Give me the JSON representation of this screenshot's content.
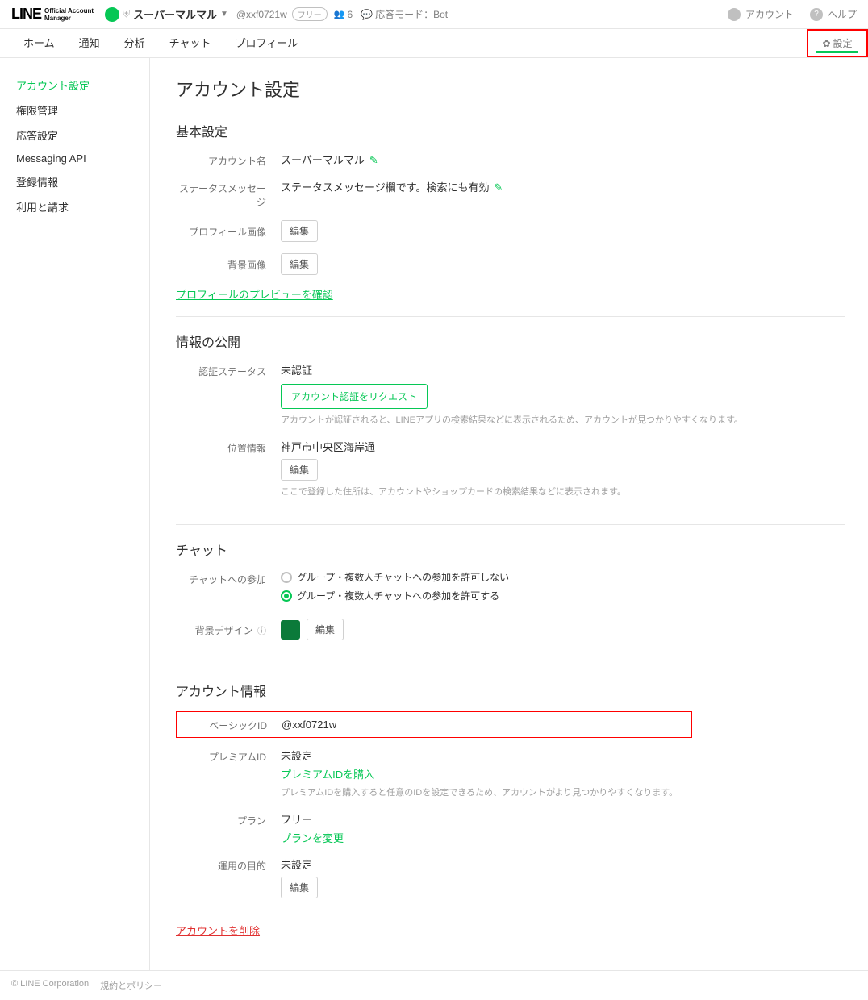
{
  "topbar": {
    "logo": "LINE",
    "logo_sub": "Official Account\nManager",
    "account_name": "スーパーマルマル",
    "handle": "@xxf0721w",
    "plan_pill": "フリー",
    "members": "6",
    "response_mode": "応答モード：Bot",
    "right": {
      "account": "アカウント",
      "help": "ヘルプ"
    }
  },
  "nav": {
    "items": [
      "ホーム",
      "通知",
      "分析",
      "チャット",
      "プロフィール"
    ],
    "settings": "設定"
  },
  "sidebar": {
    "items": [
      "アカウント設定",
      "権限管理",
      "応答設定",
      "Messaging API",
      "登録情報",
      "利用と請求"
    ]
  },
  "page": {
    "title": "アカウント設定"
  },
  "basic": {
    "heading": "基本設定",
    "account_name_label": "アカウント名",
    "account_name_value": "スーパーマルマル",
    "status_label": "ステータスメッセージ",
    "status_value": "ステータスメッセージ欄です。検索にも有効",
    "profile_image_label": "プロフィール画像",
    "bg_image_label": "背景画像",
    "edit": "編集",
    "preview_link": "プロフィールのプレビューを確認"
  },
  "disclosure": {
    "heading": "情報の公開",
    "verify_label": "認証ステータス",
    "verify_value": "未認証",
    "verify_button": "アカウント認証をリクエスト",
    "verify_hint": "アカウントが認証されると、LINEアプリの検索結果などに表示されるため、アカウントが見つかりやすくなります。",
    "location_label": "位置情報",
    "location_value": "神戸市中央区海岸通",
    "location_hint": "ここで登録した住所は、アカウントやショップカードの検索結果などに表示されます。",
    "edit": "編集"
  },
  "chat": {
    "heading": "チャット",
    "join_label": "チャットへの参加",
    "opt_off": "グループ・複数人チャットへの参加を許可しない",
    "opt_on": "グループ・複数人チャットへの参加を許可する",
    "bg_label": "背景デザイン",
    "edit": "編集"
  },
  "account_info": {
    "heading": "アカウント情報",
    "basic_id_label": "ベーシックID",
    "basic_id_value": "@xxf0721w",
    "premium_id_label": "プレミアムID",
    "premium_id_value": "未設定",
    "premium_link": "プレミアムIDを購入",
    "premium_hint": "プレミアムIDを購入すると任意のIDを設定できるため、アカウントがより見つかりやすくなります。",
    "plan_label": "プラン",
    "plan_value": "フリー",
    "plan_link": "プランを変更",
    "purpose_label": "運用の目的",
    "purpose_value": "未設定",
    "edit": "編集"
  },
  "delete_link": "アカウントを削除",
  "footer": {
    "copyright": "© LINE Corporation",
    "policy": "規約とポリシー"
  }
}
